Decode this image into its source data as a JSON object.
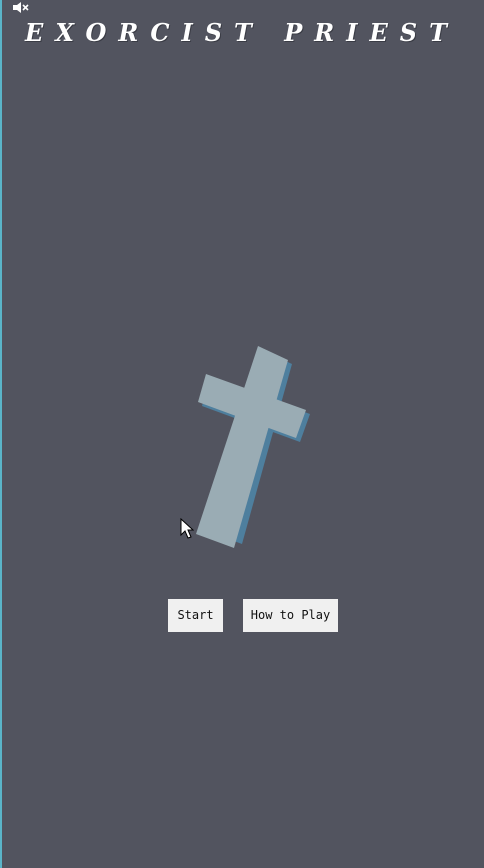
{
  "game": {
    "title": "EXORCIST PRIEST",
    "audio_state": "muted",
    "start_label": "Start",
    "how_to_play_label": "How to Play"
  },
  "icons": {
    "mute": "speaker-muted-icon",
    "cross": "cross-icon",
    "cursor": "mouse-pointer-icon"
  },
  "colors": {
    "background": "#52545f",
    "title": "#ffffff",
    "cross_front": "#9aacb4",
    "cross_side": "#4e7f9e",
    "button": "#f0f0f0",
    "edge": "#5ab4c8"
  }
}
